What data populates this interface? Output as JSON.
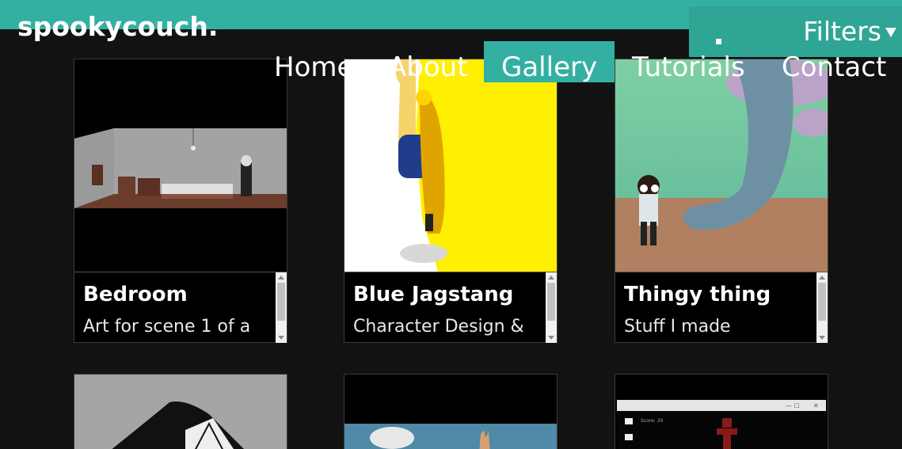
{
  "header": {
    "logo": "spookycouch.",
    "filters_label": "Filters"
  },
  "nav": {
    "items": [
      {
        "label": "Home"
      },
      {
        "label": "About"
      },
      {
        "label": "Gallery",
        "active": true
      },
      {
        "label": "Tutorials"
      },
      {
        "label": "Contact"
      }
    ]
  },
  "gallery": {
    "cards": [
      {
        "title": "Bedroom",
        "description": "Art for scene 1 of a"
      },
      {
        "title": "Blue Jagstang",
        "description": "Character Design &"
      },
      {
        "title": "Thingy thing",
        "description": "Stuff I made"
      }
    ],
    "game_thumb": {
      "score_text": "Score: 20"
    }
  },
  "colors": {
    "accent": "#33b0a2",
    "background": "#121212"
  }
}
